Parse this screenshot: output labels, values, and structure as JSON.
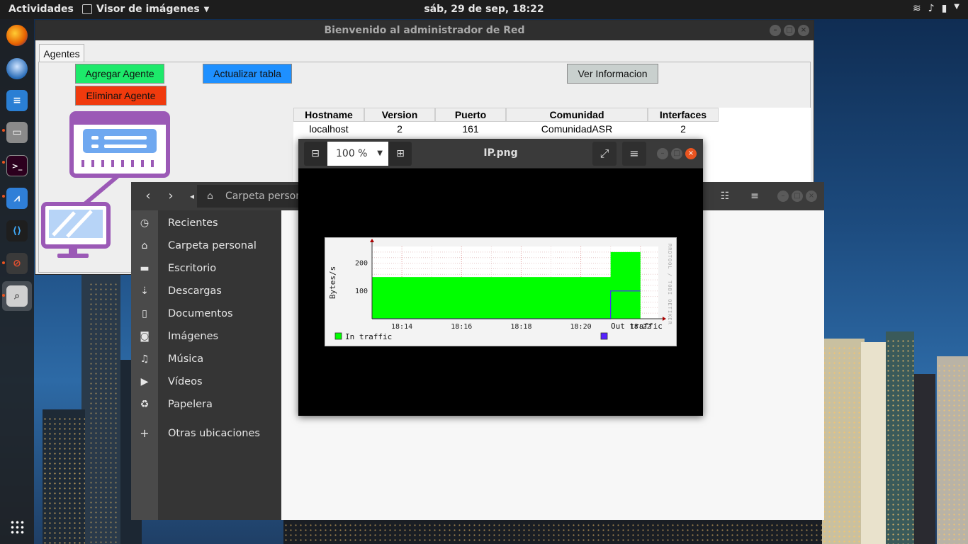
{
  "topbar": {
    "activities": "Actividades",
    "app_name": "Visor de imágenes",
    "clock": "sáb, 29 de sep, 18:22"
  },
  "admin_window": {
    "title": "Bienvenido al administrador de Red",
    "tab": "Agentes",
    "buttons": {
      "add": "Agregar Agente",
      "refresh": "Actualizar tabla",
      "info": "Ver Informacion",
      "remove": "Eliminar Agente"
    },
    "colors": {
      "add": "#1de96a",
      "refresh": "#1e90ff",
      "info": "#c9d0ce",
      "remove": "#f03a0d",
      "illustration": "#9b59b6"
    },
    "table": {
      "headers": [
        "Hostname",
        "Version",
        "Puerto",
        "Comunidad",
        "Interfaces"
      ],
      "rows": [
        [
          "localhost",
          "2",
          "161",
          "ComunidadASR",
          "2"
        ]
      ]
    }
  },
  "files_window": {
    "breadcrumb": "Carpeta personal",
    "sidebar": [
      {
        "label": "Recientes",
        "icon": "clock-icon"
      },
      {
        "label": "Carpeta personal",
        "icon": "home-icon"
      },
      {
        "label": "Escritorio",
        "icon": "folder-icon"
      },
      {
        "label": "Descargas",
        "icon": "download-icon"
      },
      {
        "label": "Documentos",
        "icon": "document-icon"
      },
      {
        "label": "Imágenes",
        "icon": "camera-icon"
      },
      {
        "label": "Música",
        "icon": "music-icon"
      },
      {
        "label": "Vídeos",
        "icon": "video-icon"
      },
      {
        "label": "Papelera",
        "icon": "trash-icon"
      },
      {
        "label": "Otras ubicaciones",
        "icon": "plus-icon"
      }
    ]
  },
  "viewer_window": {
    "title": "IP.png",
    "zoom": "100 %"
  },
  "chart_data": {
    "type": "area",
    "ylabel": "Bytes/s",
    "x_ticks": [
      "18:14",
      "18:16",
      "18:18",
      "18:20",
      "18:22"
    ],
    "y_ticks": [
      100,
      200
    ],
    "ylim": [
      0,
      260
    ],
    "watermark": "RRDTOOL / TOBI OETIKER",
    "grid": true,
    "series": [
      {
        "name": "In traffic",
        "color": "#00ff00",
        "points": [
          [
            "18:13",
            150
          ],
          [
            "18:21",
            150
          ],
          [
            "18:21",
            240
          ],
          [
            "18:22",
            240
          ]
        ]
      },
      {
        "name": "Out traffic",
        "color": "#5522ff",
        "points": [
          [
            "18:13",
            0
          ],
          [
            "18:21",
            0
          ],
          [
            "18:21",
            100
          ],
          [
            "18:22",
            100
          ]
        ]
      }
    ]
  }
}
